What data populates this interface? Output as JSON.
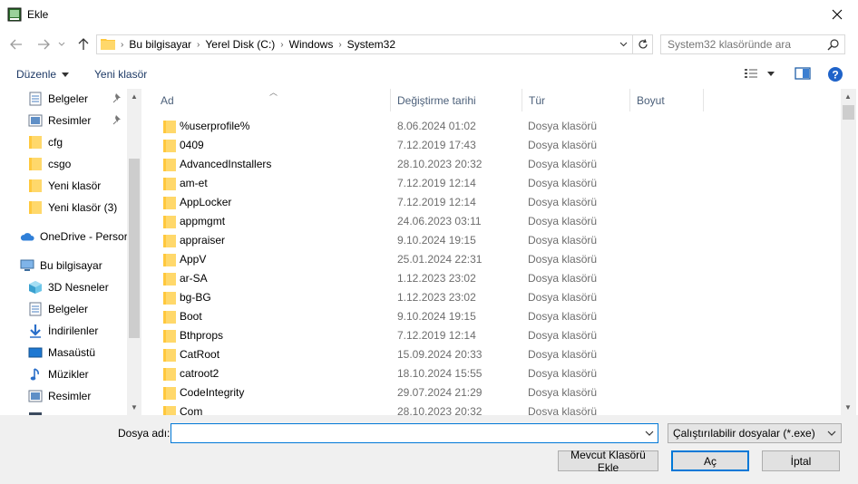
{
  "window": {
    "title": "Ekle"
  },
  "address": {
    "crumbs": [
      "Bu bilgisayar",
      "Yerel Disk (C:)",
      "Windows",
      "System32"
    ]
  },
  "search": {
    "placeholder": "System32 klasöründe ara"
  },
  "toolbar": {
    "organize_label": "Düzenle",
    "new_folder_label": "Yeni klasör"
  },
  "sidebar": {
    "items": [
      {
        "label": "Belgeler",
        "icon": "documents-icon",
        "pinned": true
      },
      {
        "label": "Resimler",
        "icon": "pictures-icon",
        "pinned": true
      },
      {
        "label": "cfg",
        "icon": "folder-icon",
        "pinned": false
      },
      {
        "label": "csgo",
        "icon": "folder-icon",
        "pinned": false
      },
      {
        "label": "Yeni klasör",
        "icon": "folder-icon",
        "pinned": false
      },
      {
        "label": "Yeni klasör (3)",
        "icon": "folder-icon",
        "pinned": false
      },
      {
        "label": "OneDrive - Persor",
        "icon": "onedrive-icon",
        "pinned": false
      },
      {
        "label": "Bu bilgisayar",
        "icon": "computer-icon",
        "pinned": false
      },
      {
        "label": "3D Nesneler",
        "icon": "3d-objects-icon",
        "pinned": false
      },
      {
        "label": "Belgeler",
        "icon": "documents-icon",
        "pinned": false
      },
      {
        "label": "İndirilenler",
        "icon": "downloads-icon",
        "pinned": false
      },
      {
        "label": "Masaüstü",
        "icon": "desktop-icon",
        "pinned": false
      },
      {
        "label": "Müzikler",
        "icon": "music-icon",
        "pinned": false
      },
      {
        "label": "Resimler",
        "icon": "pictures-icon",
        "pinned": false
      }
    ]
  },
  "columns": {
    "name": "Ad",
    "modified": "Değiştirme tarihi",
    "type": "Tür",
    "size": "Boyut"
  },
  "files": [
    {
      "name": "%userprofile%",
      "modified": "8.06.2024 01:02",
      "type": "Dosya klasörü"
    },
    {
      "name": "0409",
      "modified": "7.12.2019 17:43",
      "type": "Dosya klasörü"
    },
    {
      "name": "AdvancedInstallers",
      "modified": "28.10.2023 20:32",
      "type": "Dosya klasörü"
    },
    {
      "name": "am-et",
      "modified": "7.12.2019 12:14",
      "type": "Dosya klasörü"
    },
    {
      "name": "AppLocker",
      "modified": "7.12.2019 12:14",
      "type": "Dosya klasörü"
    },
    {
      "name": "appmgmt",
      "modified": "24.06.2023 03:11",
      "type": "Dosya klasörü"
    },
    {
      "name": "appraiser",
      "modified": "9.10.2024 19:15",
      "type": "Dosya klasörü"
    },
    {
      "name": "AppV",
      "modified": "25.01.2024 22:31",
      "type": "Dosya klasörü"
    },
    {
      "name": "ar-SA",
      "modified": "1.12.2023 23:02",
      "type": "Dosya klasörü"
    },
    {
      "name": "bg-BG",
      "modified": "1.12.2023 23:02",
      "type": "Dosya klasörü"
    },
    {
      "name": "Boot",
      "modified": "9.10.2024 19:15",
      "type": "Dosya klasörü"
    },
    {
      "name": "Bthprops",
      "modified": "7.12.2019 12:14",
      "type": "Dosya klasörü"
    },
    {
      "name": "CatRoot",
      "modified": "15.09.2024 20:33",
      "type": "Dosya klasörü"
    },
    {
      "name": "catroot2",
      "modified": "18.10.2024 15:55",
      "type": "Dosya klasörü"
    },
    {
      "name": "CodeIntegrity",
      "modified": "29.07.2024 21:29",
      "type": "Dosya klasörü"
    },
    {
      "name": "Com",
      "modified": "28.10.2023 20:32",
      "type": "Dosya klasörü"
    }
  ],
  "bottom": {
    "filename_label": "Dosya adı:",
    "filename_value": "",
    "filter_value": "Çalıştırılabilir dosyalar (*.exe)",
    "new_folder_button": "Mevcut Klasörü Ekle",
    "open_button": "Aç",
    "cancel_button": "İptal"
  },
  "colors": {
    "accent": "#0078d7",
    "folder": "#ffc83d",
    "header_text": "#4c607a"
  }
}
